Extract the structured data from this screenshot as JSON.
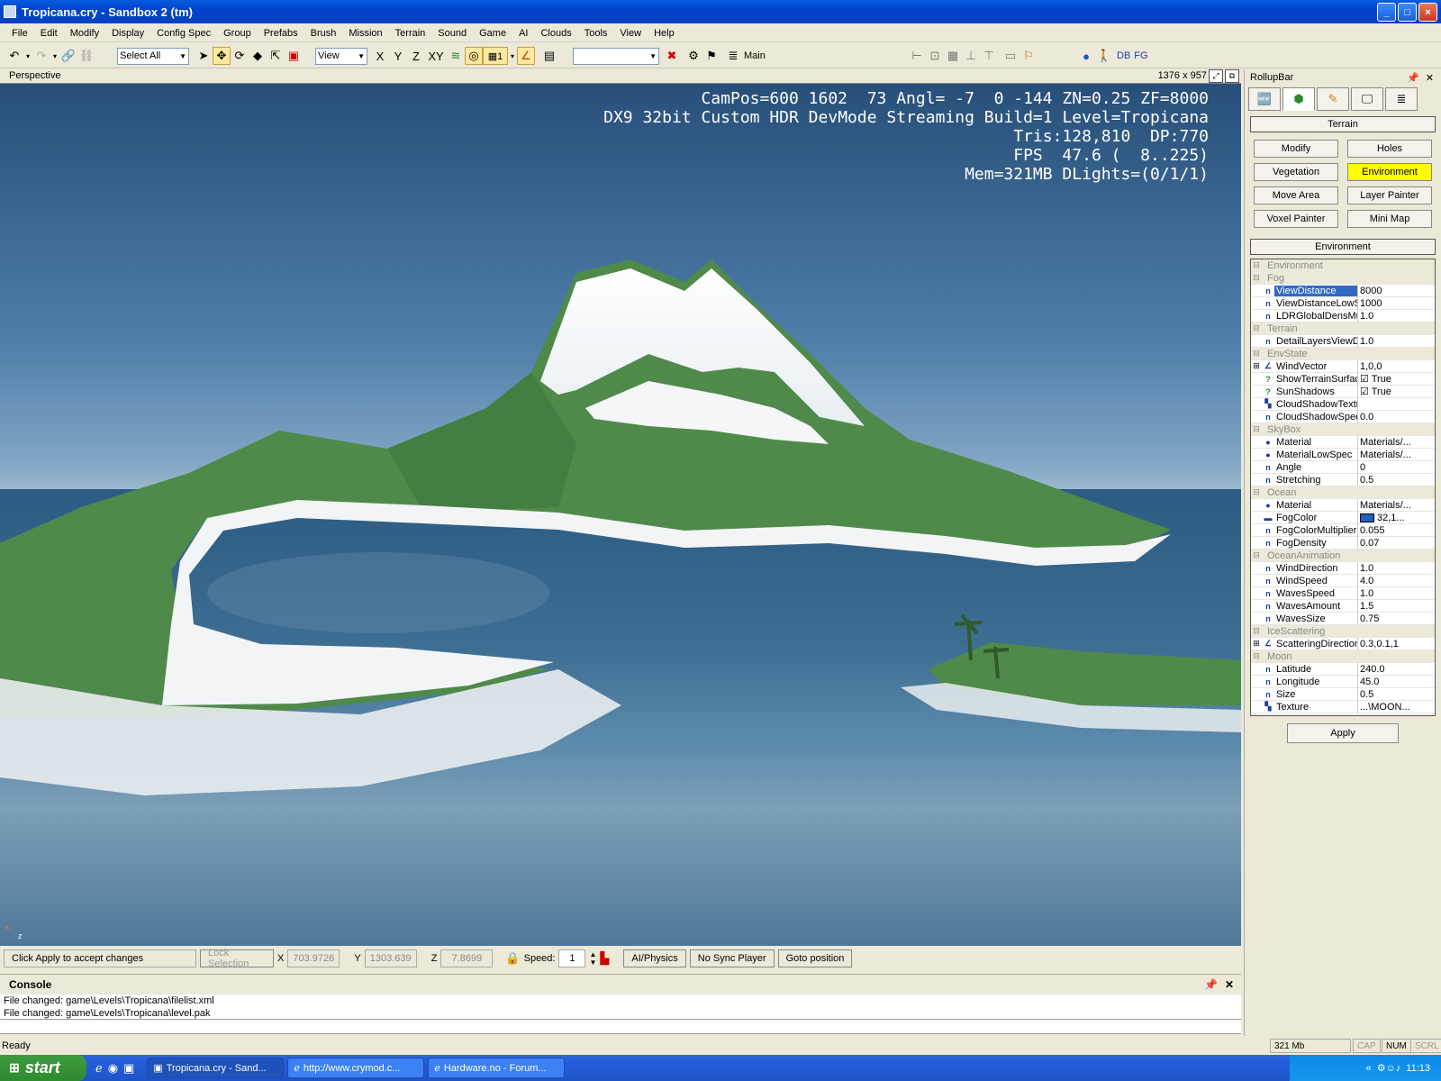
{
  "window": {
    "title": "Tropicana.cry - Sandbox 2 (tm)",
    "buttons": [
      "_",
      "□",
      "×"
    ]
  },
  "menu": [
    "File",
    "Edit",
    "Modify",
    "Display",
    "Config Spec",
    "Group",
    "Prefabs",
    "Brush",
    "Mission",
    "Terrain",
    "Sound",
    "Game",
    "AI",
    "Clouds",
    "Tools",
    "View",
    "Help"
  ],
  "toolbar": {
    "selection": "Select All",
    "coord_system": "View",
    "axes": [
      "X",
      "Y",
      "Z",
      "XY"
    ],
    "layer": "Main",
    "right_labels": [
      "DB",
      "FG"
    ]
  },
  "viewport": {
    "name": "Perspective",
    "resolution": "1376 x 957",
    "hud": [
      "CamPos=600 1602  73 Angl= -7  0 -144 ZN=0.25 ZF=8000",
      "DX9 32bit Custom HDR DevMode Streaming Build=1 Level=Tropicana",
      "Tris:128,810  DP:770",
      "FPS  47.6 (  8..225)",
      "Mem=321MB DLights=(0/1/1)"
    ],
    "axis_labels": [
      "x",
      "z"
    ]
  },
  "rollup": {
    "title": "RollupBar",
    "section": "Terrain",
    "buttons": [
      "Modify",
      "Holes",
      "Vegetation",
      "Environment",
      "Move Area",
      "Layer Painter",
      "Voxel Painter",
      "Mini Map"
    ],
    "active_button": "Environment",
    "panel_title": "Environment",
    "apply": "Apply",
    "properties": [
      {
        "cat": "Environment"
      },
      {
        "cat": "Fog"
      },
      {
        "name": "ViewDistance",
        "value": "8000",
        "icon": "n",
        "sel": true
      },
      {
        "name": "ViewDistanceLowS",
        "value": "1000",
        "icon": "n"
      },
      {
        "name": "LDRGlobalDensMul",
        "value": "1.0",
        "icon": "n"
      },
      {
        "cat": "Terrain"
      },
      {
        "name": "DetailLayersViewD",
        "value": "1.0",
        "icon": "n"
      },
      {
        "cat": "EnvState"
      },
      {
        "name": "WindVector",
        "value": "1,0,0",
        "icon": "vec",
        "exp": "+"
      },
      {
        "name": "ShowTerrainSurfac",
        "value": "☑ True",
        "icon": "?"
      },
      {
        "name": "SunShadows",
        "value": "☑ True",
        "icon": "?"
      },
      {
        "name": "CloudShadowTextu",
        "value": "",
        "icon": "tex"
      },
      {
        "name": "CloudShadowSpee",
        "value": "0.0",
        "icon": "n"
      },
      {
        "cat": "SkyBox"
      },
      {
        "name": "Material",
        "value": "Materials/...",
        "icon": "dot"
      },
      {
        "name": "MaterialLowSpec",
        "value": "Materials/...",
        "icon": "dot"
      },
      {
        "name": "Angle",
        "value": "0",
        "icon": "n"
      },
      {
        "name": "Stretching",
        "value": "0.5",
        "icon": "n"
      },
      {
        "cat": "Ocean"
      },
      {
        "name": "Material",
        "value": "Materials/...",
        "icon": "dot"
      },
      {
        "name": "FogColor",
        "value": "32,1...",
        "icon": "col",
        "swatch": "#2060c0"
      },
      {
        "name": "FogColorMultiplier",
        "value": "0.055",
        "icon": "n"
      },
      {
        "name": "FogDensity",
        "value": "0.07",
        "icon": "n"
      },
      {
        "cat": "OceanAnimation"
      },
      {
        "name": "WindDirection",
        "value": "1.0",
        "icon": "n"
      },
      {
        "name": "WindSpeed",
        "value": "4.0",
        "icon": "n"
      },
      {
        "name": "WavesSpeed",
        "value": "1.0",
        "icon": "n"
      },
      {
        "name": "WavesAmount",
        "value": "1.5",
        "icon": "n"
      },
      {
        "name": "WavesSize",
        "value": "0.75",
        "icon": "n"
      },
      {
        "cat": "IceScattering"
      },
      {
        "name": "ScatteringDirection",
        "value": "0.3,0.1,1",
        "icon": "vec",
        "exp": "+"
      },
      {
        "cat": "Moon"
      },
      {
        "name": "Latitude",
        "value": "240.0",
        "icon": "n"
      },
      {
        "name": "Longitude",
        "value": "45.0",
        "icon": "n"
      },
      {
        "name": "Size",
        "value": "0.5",
        "icon": "n"
      },
      {
        "name": "Texture",
        "value": "...\\MOON...",
        "icon": "tex"
      }
    ]
  },
  "status": {
    "message": "Click Apply to accept changes",
    "lock": "Lock Selection",
    "x_label": "X",
    "x": "703.9726",
    "y_label": "Y",
    "y": "1303.639",
    "z_label": "Z",
    "z": "7.8699",
    "speed_label": "Speed:",
    "speed": "1",
    "ai_physics": "AI/Physics",
    "sync": "No Sync Player",
    "goto": "Goto position"
  },
  "console": {
    "title": "Console",
    "lines": [
      "File changed: game\\Levels\\Tropicana\\filelist.xml",
      "File changed: game\\Levels\\Tropicana\\level.pak"
    ]
  },
  "statusbar": {
    "ready": "Ready",
    "mem": "321 Mb",
    "cap": "CAP",
    "num": "NUM",
    "scrl": "SCRL"
  },
  "taskbar": {
    "start": "start",
    "tasks": [
      "Tropicana.cry - Sand...",
      "http://www.crymod.c...",
      "Hardware.no - Forum..."
    ],
    "clock": "11:13"
  },
  "colors": {
    "title_bar": "#0a5be0",
    "active_button": "#ffff00",
    "selection": "#316ac5"
  }
}
